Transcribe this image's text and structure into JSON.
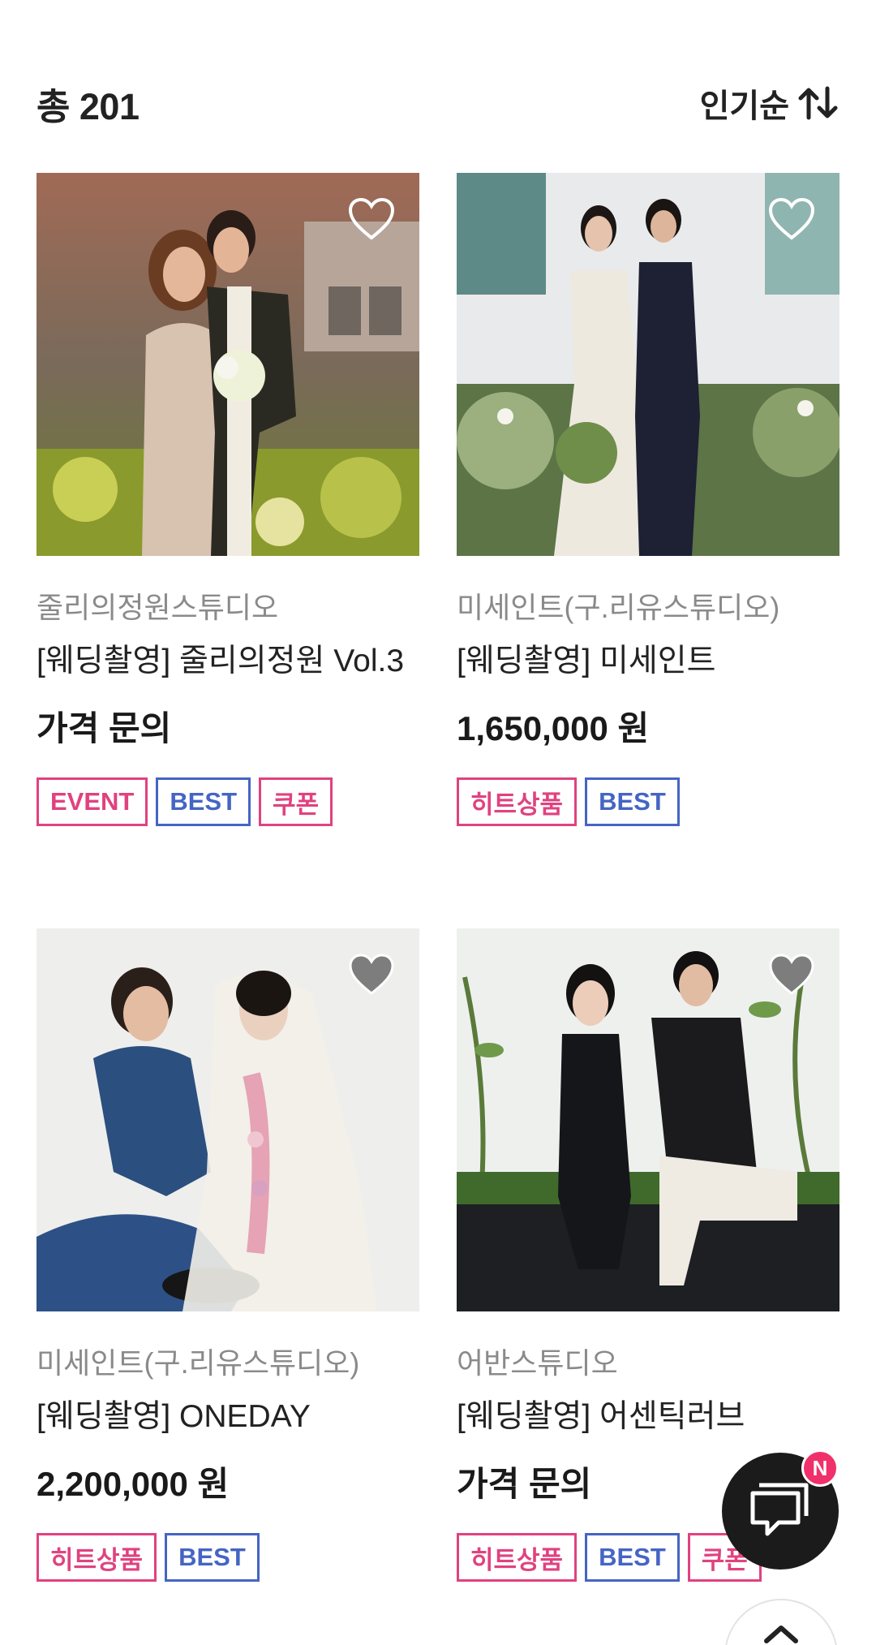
{
  "header": {
    "total_label": "총 201",
    "sort_label": "인기순"
  },
  "products": [
    {
      "studio": "줄리의정원스튜디오",
      "title": "[웨딩촬영] 줄리의정원 Vol.3",
      "price": "가격 문의",
      "liked": false,
      "tags": [
        {
          "label": "EVENT",
          "style": "pink"
        },
        {
          "label": "BEST",
          "style": "blue"
        },
        {
          "label": "쿠폰",
          "style": "pink"
        }
      ]
    },
    {
      "studio": "미세인트(구.리유스튜디오)",
      "title": "[웨딩촬영] 미세인트",
      "price": "1,650,000 원",
      "liked": false,
      "tags": [
        {
          "label": "히트상품",
          "style": "pink"
        },
        {
          "label": "BEST",
          "style": "blue"
        }
      ]
    },
    {
      "studio": "미세인트(구.리유스튜디오)",
      "title": "[웨딩촬영] ONEDAY",
      "price": "2,200,000 원",
      "liked": false,
      "tags": [
        {
          "label": "히트상품",
          "style": "pink"
        },
        {
          "label": "BEST",
          "style": "blue"
        }
      ]
    },
    {
      "studio": "어반스튜디오",
      "title": "[웨딩촬영] 어센틱러브",
      "price": "가격 문의",
      "liked": false,
      "tags": [
        {
          "label": "히트상품",
          "style": "pink"
        },
        {
          "label": "BEST",
          "style": "blue"
        },
        {
          "label": "쿠폰",
          "style": "pink"
        }
      ]
    }
  ],
  "chat": {
    "badge": "N",
    "icon": "chat-bubbles-icon"
  },
  "scroll_top": {
    "icon": "chevron-up-icon"
  },
  "colors": {
    "tag_pink": "#e0427f",
    "tag_blue": "#4565c4",
    "chat_badge": "#f0306a",
    "chat_button": "#1b1b1b"
  }
}
